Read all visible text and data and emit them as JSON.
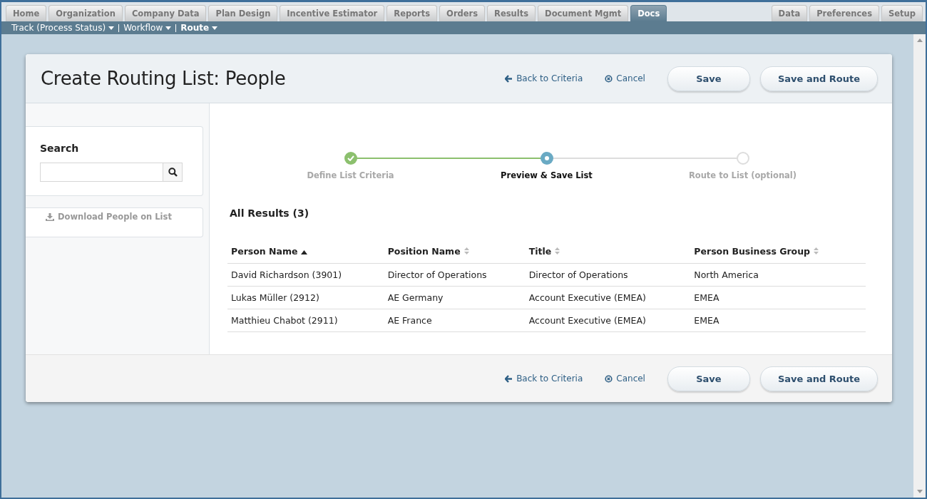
{
  "tabs_left": [
    {
      "label": "Home",
      "selected": false
    },
    {
      "label": "Organization",
      "selected": false
    },
    {
      "label": "Company Data",
      "selected": false
    },
    {
      "label": "Plan Design",
      "selected": false
    },
    {
      "label": "Incentive Estimator",
      "selected": false
    },
    {
      "label": "Reports",
      "selected": false
    },
    {
      "label": "Orders",
      "selected": false
    },
    {
      "label": "Results",
      "selected": false
    },
    {
      "label": "Document Mgmt",
      "selected": false
    },
    {
      "label": "Docs",
      "selected": true
    }
  ],
  "tabs_right": [
    {
      "label": "Data",
      "selected": false
    },
    {
      "label": "Preferences",
      "selected": false
    },
    {
      "label": "Setup",
      "selected": false
    }
  ],
  "subnav": [
    {
      "label": "Track (Process Status)",
      "selected": false
    },
    {
      "label": "Workflow",
      "selected": false
    },
    {
      "label": "Route",
      "selected": true
    }
  ],
  "page_title": "Create Routing List: People",
  "header_actions": {
    "back": "Back to Criteria",
    "cancel": "Cancel",
    "save": "Save",
    "save_route": "Save and Route"
  },
  "sidebar": {
    "search_label": "Search",
    "download": "Download People on List"
  },
  "steps": [
    {
      "label": "Define List Criteria",
      "kind": "done"
    },
    {
      "label": "Preview & Save List",
      "kind": "current"
    },
    {
      "label": "Route to List (optional)",
      "kind": "todo"
    }
  ],
  "results_heading": "All Results (3)",
  "table": {
    "columns": [
      {
        "label": "Person Name",
        "kind": "sorted"
      },
      {
        "label": "Position Name",
        "kind": "sortable"
      },
      {
        "label": "Title",
        "kind": "sortable"
      },
      {
        "label": "Person Business Group",
        "kind": "sortable"
      }
    ],
    "rows": [
      [
        "David Richardson (3901)",
        "Director of Operations",
        "Director of Operations",
        "North America"
      ],
      [
        "Lukas Müller (2912)",
        "AE Germany",
        "Account Executive (EMEA)",
        "EMEA"
      ],
      [
        "Matthieu Chabot (2911)",
        "AE France",
        "Account Executive (EMEA)",
        "EMEA"
      ]
    ]
  },
  "footer_actions": {
    "back": "Back to Criteria",
    "cancel": "Cancel",
    "save": "Save",
    "save_route": "Save and Route"
  }
}
